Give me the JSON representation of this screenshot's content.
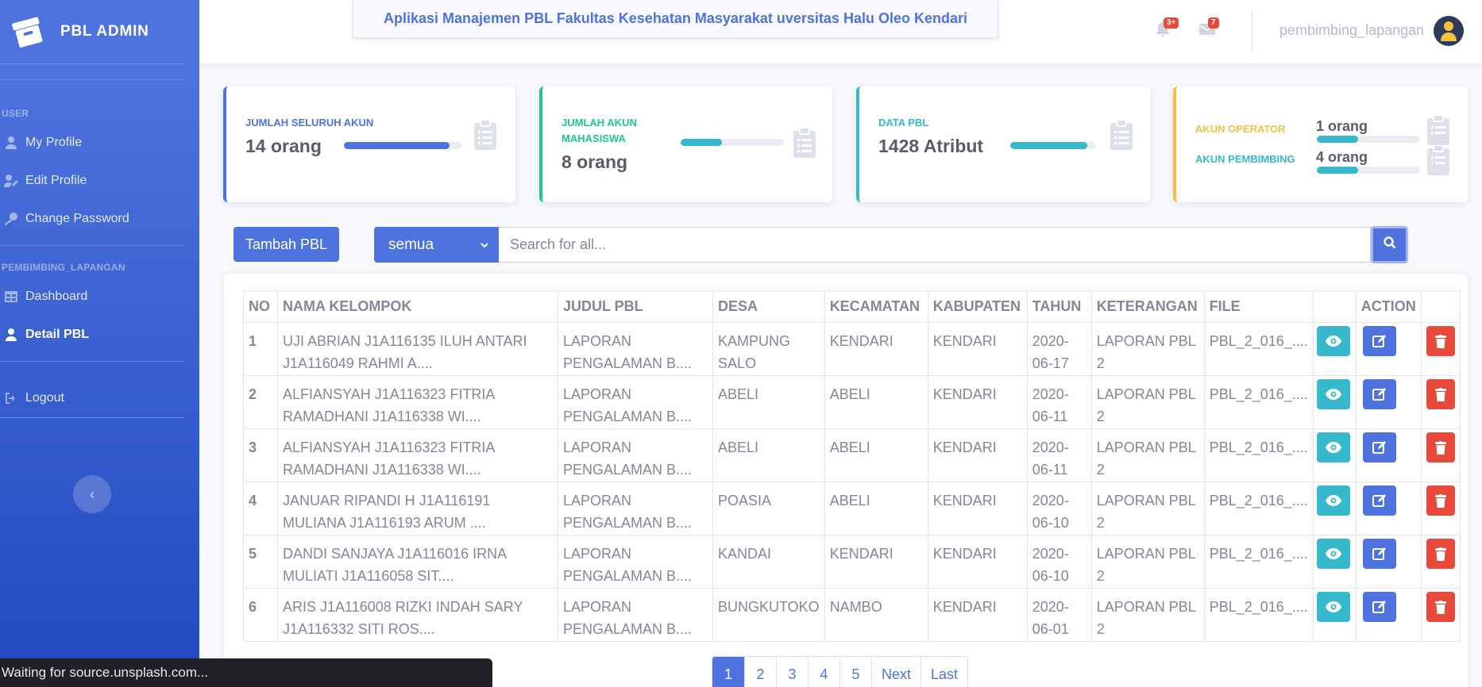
{
  "sidebar": {
    "brand": "PBL ADMIN",
    "heading_user": "USER",
    "heading_role": "PEMBIMBING_LAPANGAN",
    "items": {
      "my_profile": "My Profile",
      "edit_profile": "Edit Profile",
      "change_password": "Change Password",
      "dashboard": "Dashboard",
      "detail_pbl": "Detail PBL",
      "logout": "Logout"
    }
  },
  "topbar": {
    "app_title": "Aplikasi Manajemen PBL Fakultas Kesehatan Masyarakat uversitas Halu Oleo Kendari",
    "alerts_badge": "3+",
    "messages_badge": "7",
    "username": "pembimbing_lapangan"
  },
  "cards": [
    {
      "label": "JUMLAH SELURUH AKUN",
      "value": "14 orang",
      "progress": 0.9,
      "color": "#4e73df"
    },
    {
      "label": "JUMLAH AKUN MAHASISWA",
      "value": "8 orang",
      "progress": 0.4,
      "color": "#36b9cc",
      "label_color": "#1cc88a"
    },
    {
      "label": "DATA PBL",
      "value": "1428 Atribut",
      "progress": 0.9,
      "color": "#36b9cc"
    },
    {
      "operator_label": "AKUN OPERATOR",
      "operator_value": "1 orang",
      "operator_progress": 0.4,
      "pembimbing_label": "AKUN PEMBIMBING",
      "pembimbing_value": "4 orang",
      "pembimbing_progress": 0.4
    }
  ],
  "controls": {
    "add_button": "Tambah PBL",
    "filter_selected": "semua",
    "search_placeholder": "Search for all..."
  },
  "table": {
    "headers": [
      "NO",
      "NAMA KELOMPOK",
      "JUDUL PBL",
      "DESA",
      "KECAMATAN",
      "KABUPATEN",
      "TAHUN",
      "KETERANGAN",
      "FILE",
      "",
      "ACTION",
      ""
    ],
    "rows": [
      {
        "no": "1",
        "nama": "UJI ABRIAN J1A116135 ILUH ANTARI J1A116049 RAHMI A....",
        "judul": "LAPORAN PENGALAMAN B....",
        "desa": "KAMPUNG SALO",
        "kecamatan": "KENDARI",
        "kabupaten": "KENDARI",
        "tahun": "2020-06-17",
        "keterangan": "LAPORAN PBL 2",
        "file": "PBL_2_016_...."
      },
      {
        "no": "2",
        "nama": "ALFIANSYAH J1A116323 FITRIA RAMADHANI J1A116338 WI....",
        "judul": "LAPORAN PENGALAMAN B....",
        "desa": "ABELI",
        "kecamatan": "ABELI",
        "kabupaten": "KENDARI",
        "tahun": "2020-06-11",
        "keterangan": "LAPORAN PBL 2",
        "file": "PBL_2_016_...."
      },
      {
        "no": "3",
        "nama": "ALFIANSYAH J1A116323 FITRIA RAMADHANI J1A116338 WI....",
        "judul": "LAPORAN PENGALAMAN B....",
        "desa": "ABELI",
        "kecamatan": "ABELI",
        "kabupaten": "KENDARI",
        "tahun": "2020-06-11",
        "keterangan": "LAPORAN PBL 2",
        "file": "PBL_2_016_...."
      },
      {
        "no": "4",
        "nama": "JANUAR RIPANDI H J1A116191 MULIANA J1A116193 ARUM ....",
        "judul": "LAPORAN PENGALAMAN B....",
        "desa": "POASIA",
        "kecamatan": "ABELI",
        "kabupaten": "KENDARI",
        "tahun": "2020-06-10",
        "keterangan": "LAPORAN PBL 2",
        "file": "PBL_2_016_...."
      },
      {
        "no": "5",
        "nama": "DANDI SANJAYA J1A116016 IRNA MULIATI J1A116058 SIT....",
        "judul": "LAPORAN PENGALAMAN B....",
        "desa": "KANDAI",
        "kecamatan": "KENDARI",
        "kabupaten": "KENDARI",
        "tahun": "2020-06-10",
        "keterangan": "LAPORAN PBL 2",
        "file": "PBL_2_016_...."
      },
      {
        "no": "6",
        "nama": "ARIS J1A116008 RIZKI INDAH SARY J1A116332 SITI ROS....",
        "judul": "LAPORAN PENGALAMAN B....",
        "desa": "BUNGKUTOKO",
        "kecamatan": "NAMBO",
        "kabupaten": "KENDARI",
        "tahun": "2020-06-01",
        "keterangan": "LAPORAN PBL 2",
        "file": "PBL_2_016_...."
      }
    ]
  },
  "pagination": {
    "pages": [
      "1",
      "2",
      "3",
      "4",
      "5"
    ],
    "active": "1",
    "next": "Next",
    "last": "Last"
  },
  "status_bar": "Waiting for source.unsplash.com...",
  "icons": {
    "view": "eye-icon",
    "edit": "edit-icon",
    "delete": "trash-icon"
  },
  "colors": {
    "primary": "#4e73df",
    "info": "#36b9cc",
    "success": "#1cc88a",
    "warning": "#f6c23e",
    "danger": "#e74a3b"
  }
}
